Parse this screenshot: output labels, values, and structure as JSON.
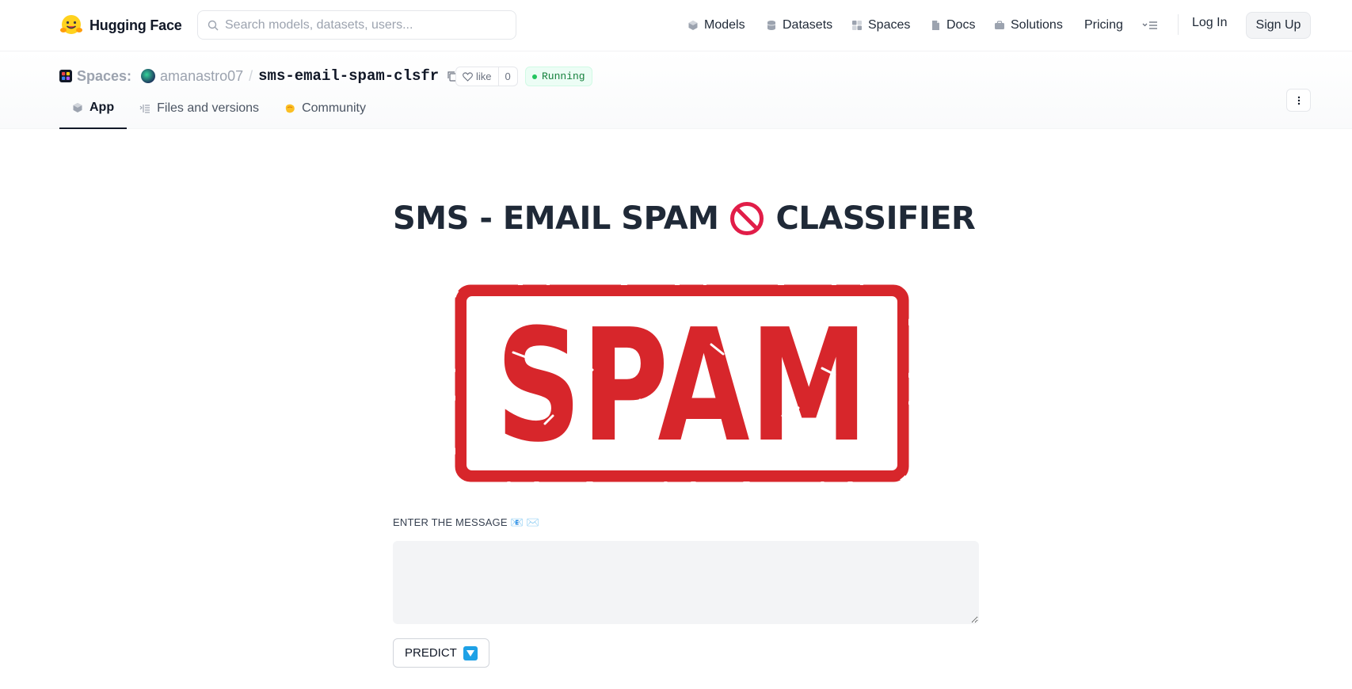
{
  "header": {
    "brand": "Hugging Face",
    "search_placeholder": "Search models, datasets, users...",
    "nav": [
      {
        "label": "Models",
        "icon": "cube-icon"
      },
      {
        "label": "Datasets",
        "icon": "database-icon"
      },
      {
        "label": "Spaces",
        "icon": "grid-icon"
      },
      {
        "label": "Docs",
        "icon": "docs-icon"
      },
      {
        "label": "Solutions",
        "icon": "briefcase-icon"
      },
      {
        "label": "Pricing",
        "icon": ""
      }
    ],
    "login": "Log In",
    "signup": "Sign Up"
  },
  "space": {
    "section": "Spaces:",
    "owner": "amanastro07",
    "separator": "/",
    "name": "sms-email-spam-clsfr",
    "like_label": "like",
    "like_count": "0",
    "status": "Running",
    "tabs": [
      {
        "label": "App",
        "icon": "cube-icon",
        "active": true
      },
      {
        "label": "Files and versions",
        "icon": "files-icon",
        "active": false
      },
      {
        "label": "Community",
        "icon": "community-icon",
        "active": false
      }
    ]
  },
  "app": {
    "title_left": "SMS - EMAIL SPAM",
    "title_right": "CLASSIFIER",
    "image_text": "SPAM",
    "input_label": "ENTER THE MESSAGE 📧 ✉️",
    "message_value": "",
    "predict_label": "PREDICT"
  },
  "colors": {
    "spam_red": "#d7262b",
    "running_green": "#22c55e",
    "predict_icon_blue": "#1ea1e6",
    "brand_yellow": "#ffd21e"
  }
}
